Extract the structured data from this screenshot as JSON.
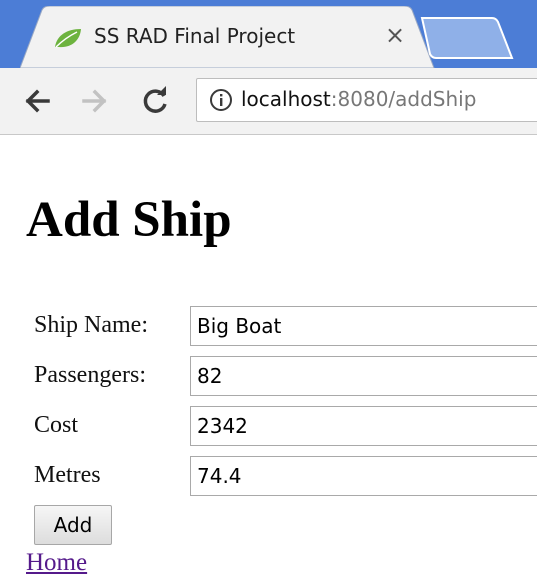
{
  "browser": {
    "tab": {
      "title": "SS RAD Final Project",
      "close_symbol": "×",
      "favicon": "spring-leaf-icon"
    },
    "toolbar": {
      "back_icon": "arrow-left-icon",
      "forward_icon": "arrow-right-icon",
      "reload_icon": "reload-icon",
      "info_icon": "info-icon",
      "url_host": "localhost",
      "url_rest": ":8080/addShip"
    }
  },
  "page": {
    "title": "Add Ship",
    "form": {
      "fields": [
        {
          "label": "Ship Name:",
          "value": "Big Boat"
        },
        {
          "label": "Passengers:",
          "value": "82"
        },
        {
          "label": "Cost",
          "value": "2342"
        },
        {
          "label": "Metres",
          "value": "74.4"
        }
      ],
      "submit_label": "Add"
    },
    "home_link": "Home"
  },
  "colors": {
    "tabstrip": "#4c7dd6",
    "favicon_green": "#6db33f",
    "link_visited": "#551a8b"
  }
}
